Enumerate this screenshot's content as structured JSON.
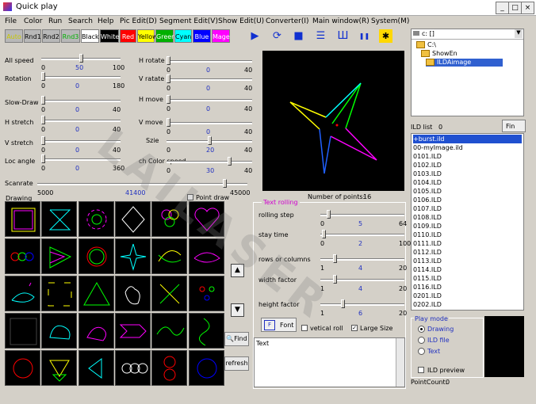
{
  "window": {
    "title": "Quick play",
    "min": "_",
    "max": "□",
    "close": "×"
  },
  "menu": [
    "File",
    "Color",
    "Run",
    "Search",
    "Help",
    "Pic Edit(D)",
    "Segment Edit(V)",
    "Show Edit(U)",
    "Converter(I)",
    "Main window(R)",
    "System(M)"
  ],
  "color_buttons": [
    {
      "label": "Auto",
      "bg": "#b8b8b8",
      "fg": "#c8c800"
    },
    {
      "label": "Rnd1",
      "bg": "#b8b8b8",
      "fg": "#000000"
    },
    {
      "label": "Rnd2",
      "bg": "#b8b8b8",
      "fg": "#000000"
    },
    {
      "label": "Rnd3",
      "bg": "#b8b8b8",
      "fg": "#00b000"
    },
    {
      "label": "Black",
      "bg": "#ffffff",
      "fg": "#000000"
    },
    {
      "label": "White",
      "bg": "#000000",
      "fg": "#ffffff"
    },
    {
      "label": "Red",
      "bg": "#ff0000",
      "fg": "#ffffff"
    },
    {
      "label": "Yellow",
      "bg": "#ffff00",
      "fg": "#000000"
    },
    {
      "label": "Green",
      "bg": "#00b000",
      "fg": "#ffffff"
    },
    {
      "label": "Cyan",
      "bg": "#00ffff",
      "fg": "#000000"
    },
    {
      "label": "Blue",
      "bg": "#0000ff",
      "fg": "#ffffff"
    },
    {
      "label": "Mage",
      "bg": "#ff00ff",
      "fg": "#ffffff"
    }
  ],
  "toolbar_icons": [
    "play-icon",
    "loop-icon",
    "stop-icon",
    "list-icon",
    "wave-icon",
    "pause-icon",
    "settings-icon"
  ],
  "left_sliders": [
    {
      "label": "All speed",
      "min": "0",
      "value": "50",
      "max": "100",
      "pos": 0.5
    },
    {
      "label": "Rotation",
      "min": "0",
      "value": "0",
      "max": "180",
      "pos": 0.0
    },
    {
      "label": "Slow-Draw",
      "min": "0",
      "value": "0",
      "max": "40",
      "pos": 0.0
    },
    {
      "label": "H stretch",
      "min": "0",
      "value": "0",
      "max": "40",
      "pos": 0.0
    },
    {
      "label": "V stretch",
      "min": "0",
      "value": "0",
      "max": "40",
      "pos": 0.0
    },
    {
      "label": "Loc angle",
      "min": "0",
      "value": "0",
      "max": "360",
      "pos": 0.0
    }
  ],
  "right_sliders": [
    {
      "label": "H rotate",
      "min": "0",
      "value": "0",
      "max": "40",
      "pos": 0.0
    },
    {
      "label": "V ratate",
      "min": "0",
      "value": "0",
      "max": "40",
      "pos": 0.0
    },
    {
      "label": "H move",
      "min": "0",
      "value": "0",
      "max": "40",
      "pos": 0.0
    },
    {
      "label": "V move",
      "min": "0",
      "value": "0",
      "max": "40",
      "pos": 0.0
    },
    {
      "label": "Szie",
      "min": "0",
      "value": "20",
      "max": "40",
      "pos": 0.5
    },
    {
      "label": "ch Color speed",
      "min": "0",
      "value": "30",
      "max": "40",
      "pos": 0.75
    }
  ],
  "scanrate": {
    "label": "Scanrate",
    "min": "5000",
    "value": "41400",
    "max": "45000",
    "pos": 0.9
  },
  "drawing_label": "Drawing",
  "point_draw": "Point draw",
  "points": {
    "label": "Number of points:",
    "value": "16"
  },
  "text_rolling": {
    "title": "Text rolling",
    "sliders": [
      {
        "label": "rolling step",
        "min": "0",
        "value": "5",
        "max": "64",
        "pos": 0.08
      },
      {
        "label": "stay time",
        "min": "0",
        "value": "2",
        "max": "100",
        "pos": 0.02
      },
      {
        "label": "rows or columns",
        "min": "1",
        "value": "4",
        "max": "20",
        "pos": 0.16
      },
      {
        "label": "width factor",
        "min": "1",
        "value": "4",
        "max": "20",
        "pos": 0.16
      },
      {
        "label": "height factor",
        "min": "1",
        "value": "6",
        "max": "20",
        "pos": 0.26
      }
    ],
    "font_btn": "Font",
    "vertical_roll": "vetical roll",
    "large_size": "Large Size",
    "text_value": "Text"
  },
  "tree": {
    "drive": "c: []",
    "items": [
      "C:\\",
      "ShowEn",
      "ILDAimage"
    ]
  },
  "ild_list": {
    "label": "ILD list",
    "count": "0",
    "find": "Fin",
    "items": [
      "+burst.ild",
      "00-myImage.ild",
      "0101.ILD",
      "0102.ILD",
      "0103.ILD",
      "0104.ILD",
      "0105.ILD",
      "0106.ILD",
      "0107.ILD",
      "0108.ILD",
      "0109.ILD",
      "0110.ILD",
      "0111.ILD",
      "0112.ILD",
      "0113.ILD",
      "0114.ILD",
      "0115.ILD",
      "0116.ILD",
      "0201.ILD",
      "0202.ILD"
    ]
  },
  "play_mode": {
    "title": "Play mode",
    "options": [
      "Drawing",
      "ILD file",
      "Text"
    ],
    "selected": "Drawing",
    "preview": "ILD preview"
  },
  "point_count": {
    "label": "PointCount:",
    "value": "0"
  },
  "side_buttons": {
    "find": "Find",
    "refresh": "refresh"
  },
  "watermark": "LAILASER"
}
